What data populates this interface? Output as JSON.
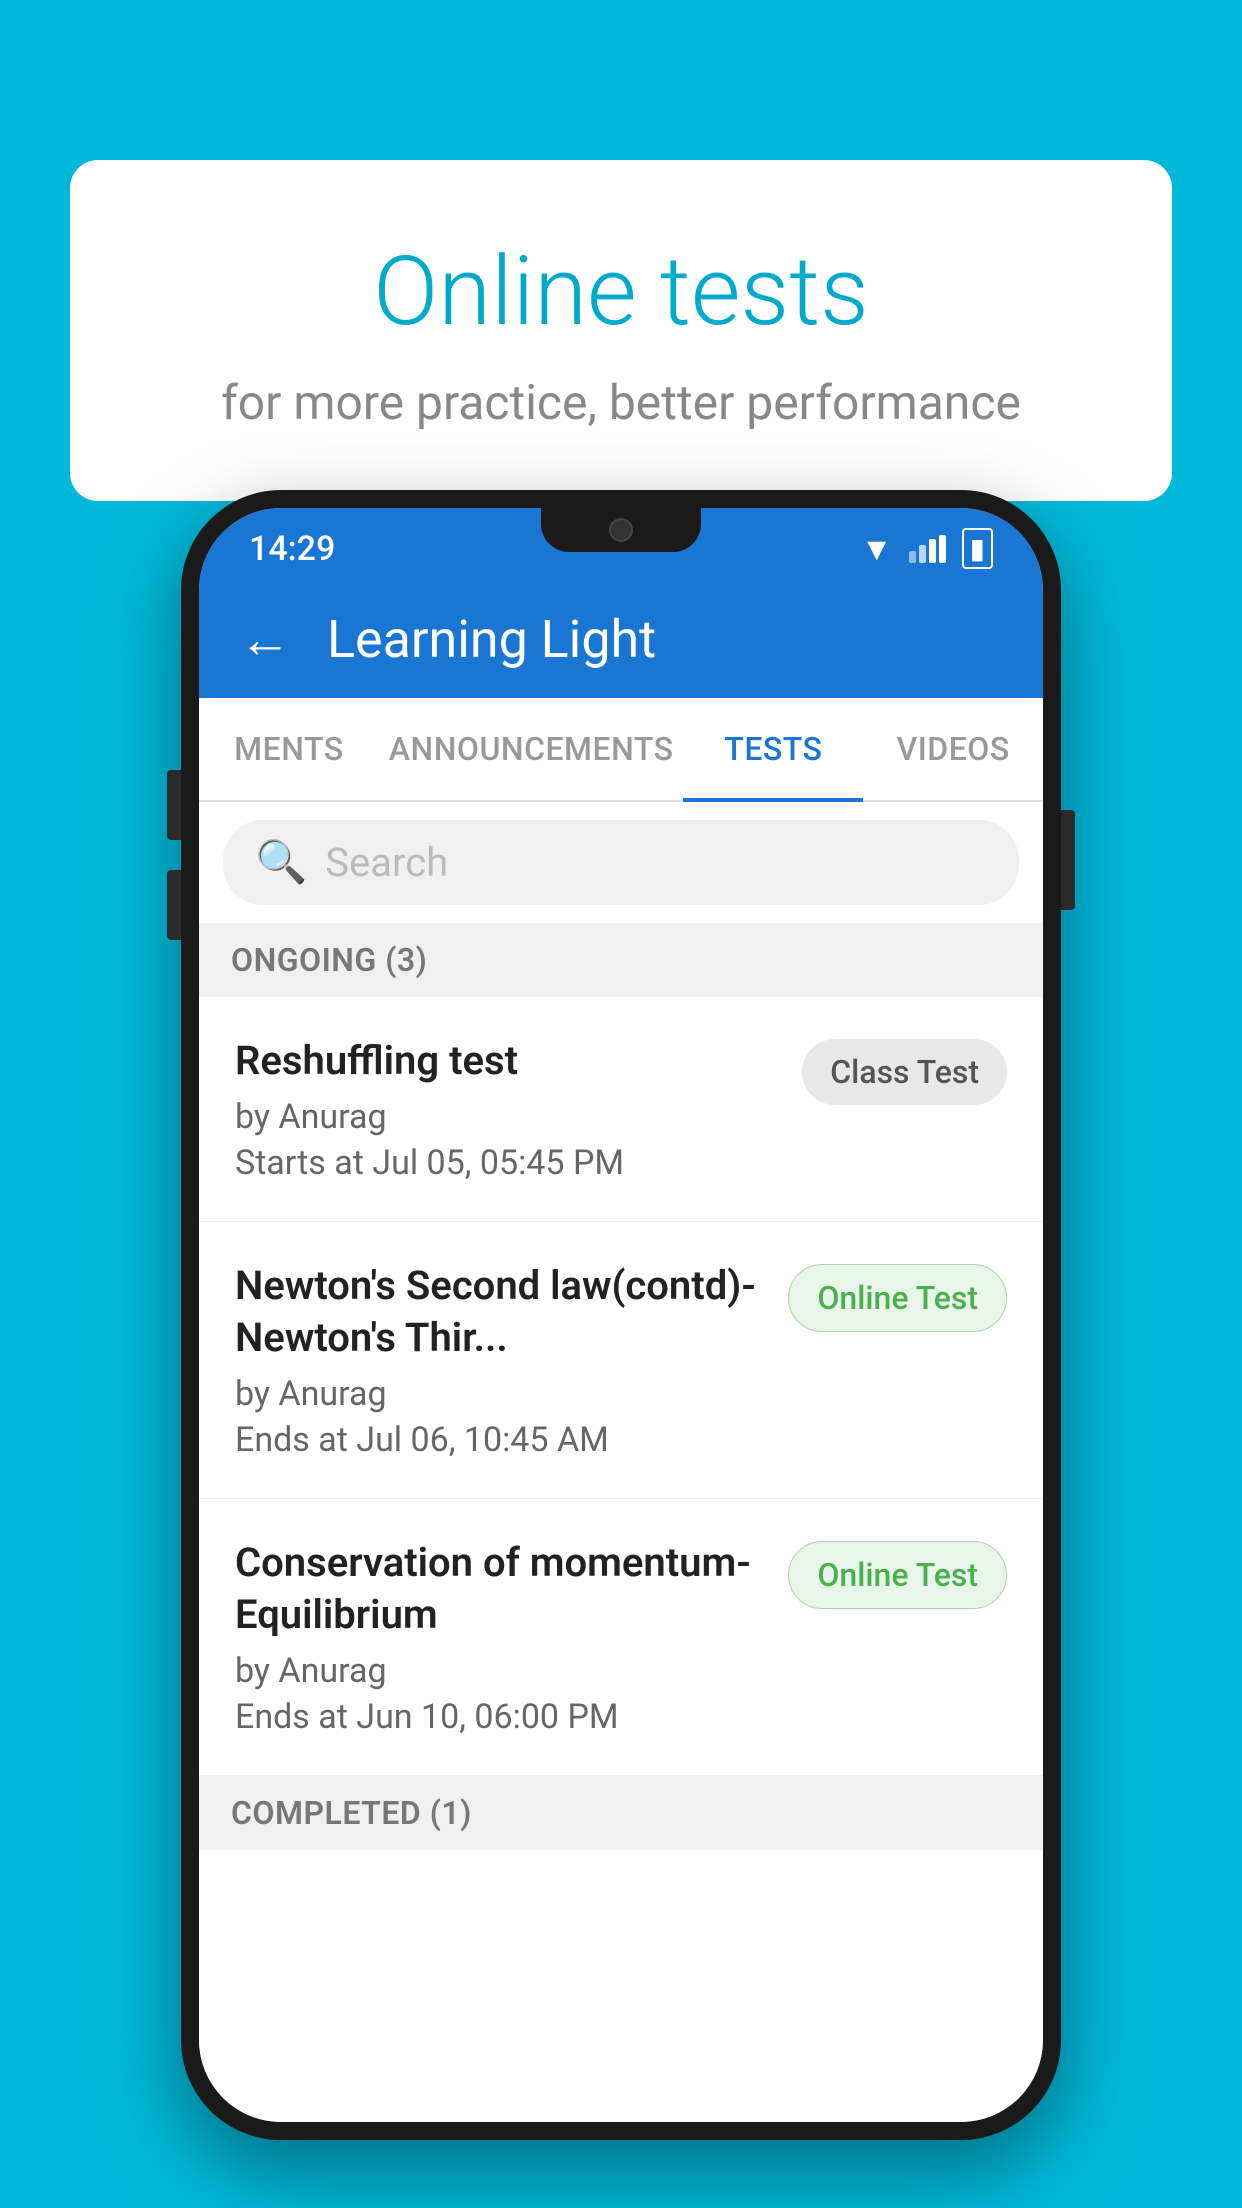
{
  "background_color": "#00b8d9",
  "speech_bubble": {
    "title": "Online tests",
    "subtitle": "for more practice, better performance"
  },
  "phone": {
    "status_bar": {
      "time": "14:29"
    },
    "app_bar": {
      "back_label": "←",
      "title": "Learning Light"
    },
    "tabs": [
      {
        "label": "MENTS",
        "active": false
      },
      {
        "label": "ANNOUNCEMENTS",
        "active": false
      },
      {
        "label": "TESTS",
        "active": true
      },
      {
        "label": "VIDEOS",
        "active": false
      }
    ],
    "search": {
      "placeholder": "Search"
    },
    "ongoing_section": {
      "label": "ONGOING (3)"
    },
    "tests": [
      {
        "name": "Reshuffling test",
        "author": "by Anurag",
        "time": "Starts at  Jul 05, 05:45 PM",
        "badge": "Class Test",
        "badge_type": "class"
      },
      {
        "name": "Newton's Second law(contd)-Newton's Thir...",
        "author": "by Anurag",
        "time": "Ends at  Jul 06, 10:45 AM",
        "badge": "Online Test",
        "badge_type": "online"
      },
      {
        "name": "Conservation of momentum-Equilibrium",
        "author": "by Anurag",
        "time": "Ends at  Jun 10, 06:00 PM",
        "badge": "Online Test",
        "badge_type": "online"
      }
    ],
    "completed_section": {
      "label": "COMPLETED (1)"
    }
  }
}
